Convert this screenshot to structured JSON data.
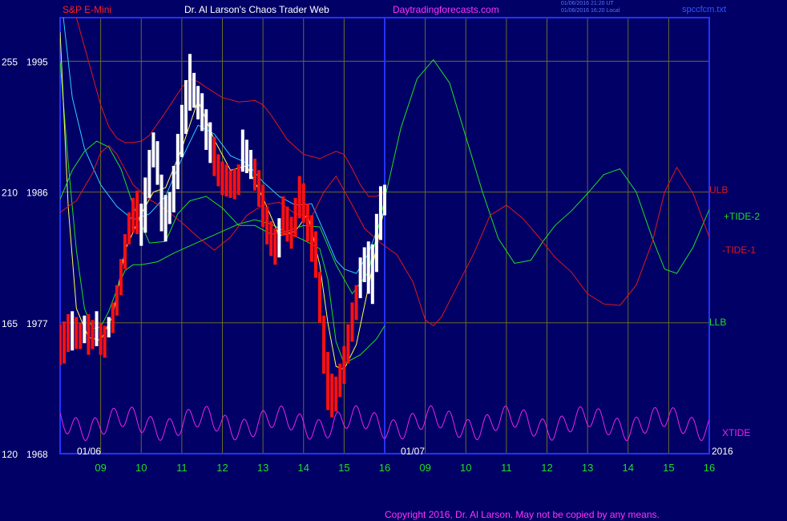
{
  "header": {
    "symbol": "S&P E-Mini",
    "author": "Dr. Al Larson's Chaos Trader Web",
    "site": "Daytradingforecasts.com",
    "stamp_line1": "01/06/2016 21:20 UT",
    "stamp_line2": "01/06/2016 16:20 Local",
    "file": "spccfcm.txt"
  },
  "footer": {
    "copyright": "Copyright 2016, Dr. Al Larson. May not be copied by any means."
  },
  "colors": {
    "background": "#000066",
    "frame": "#2233ff",
    "grid": "#6b6b2a",
    "price_up": "#ffffff",
    "price_down": "#ff1010",
    "ulb": "#e01818",
    "llb": "#22dd22",
    "tide2": "#22dd22",
    "tide1": "#e01818",
    "xtide": "#ee22ee",
    "fast_ma": "#ffff55",
    "slow_ma": "#33ccff"
  },
  "chart_data": {
    "type": "line",
    "title": "S&P E-Mini",
    "x_ticks": [
      "09",
      "10",
      "11",
      "12",
      "13",
      "14",
      "15",
      "16",
      "09",
      "10",
      "11",
      "12",
      "13",
      "14",
      "15",
      "16"
    ],
    "x_labels": {
      "start": "01/06",
      "forecast_start": "01/07",
      "year": "2016"
    },
    "y_ticks": [
      {
        "left": "255",
        "right": "1995",
        "value": 1995
      },
      {
        "left": "210",
        "right": "1986",
        "value": 1986
      },
      {
        "left": "165",
        "right": "1977",
        "value": 1977
      },
      {
        "left": "120",
        "right": "1968",
        "value": 1968
      }
    ],
    "ylim": [
      1968,
      1998
    ],
    "xlim": [
      8.0,
      24.0
    ],
    "forecast_divider_x": 16.0,
    "series_labels": {
      "ULB": "ULB",
      "TIDE2": "+TIDE-2",
      "TIDE1": "-TIDE-1",
      "LLB": "LLB",
      "XTIDE": "XTIDE"
    },
    "price_bars": [
      {
        "x": 8.0,
        "high": 1976.9,
        "low": 1974.1,
        "up": false
      },
      {
        "x": 8.1,
        "high": 1977.1,
        "low": 1974.2,
        "up": false
      },
      {
        "x": 8.2,
        "high": 1977.6,
        "low": 1975.0,
        "up": false
      },
      {
        "x": 8.3,
        "high": 1977.8,
        "low": 1975.1,
        "up": true
      },
      {
        "x": 8.4,
        "high": 1977.4,
        "low": 1975.2,
        "up": false
      },
      {
        "x": 8.5,
        "high": 1977.0,
        "low": 1975.2,
        "up": false
      },
      {
        "x": 8.6,
        "high": 1977.5,
        "low": 1975.6,
        "up": true
      },
      {
        "x": 8.7,
        "high": 1977.6,
        "low": 1974.8,
        "up": false
      },
      {
        "x": 8.8,
        "high": 1977.2,
        "low": 1975.2,
        "up": false
      },
      {
        "x": 8.9,
        "high": 1977.8,
        "low": 1975.4,
        "up": true
      },
      {
        "x": 9.0,
        "high": 1977.0,
        "low": 1974.8,
        "up": false
      },
      {
        "x": 9.1,
        "high": 1976.8,
        "low": 1974.6,
        "up": false
      },
      {
        "x": 9.2,
        "high": 1977.4,
        "low": 1976.0,
        "up": true
      },
      {
        "x": 9.3,
        "high": 1978.4,
        "low": 1976.3,
        "up": false
      },
      {
        "x": 9.4,
        "high": 1979.6,
        "low": 1977.5,
        "up": false
      },
      {
        "x": 9.5,
        "high": 1981.4,
        "low": 1978.9,
        "up": false
      },
      {
        "x": 9.6,
        "high": 1983.1,
        "low": 1980.7,
        "up": false
      },
      {
        "x": 9.7,
        "high": 1984.6,
        "low": 1982.4,
        "up": false
      },
      {
        "x": 9.8,
        "high": 1985.6,
        "low": 1983.2,
        "up": false
      },
      {
        "x": 9.9,
        "high": 1986.1,
        "low": 1983.1,
        "up": false
      },
      {
        "x": 10.0,
        "high": 1985.2,
        "low": 1982.3,
        "up": true
      },
      {
        "x": 10.1,
        "high": 1987.0,
        "low": 1983.2,
        "up": true
      },
      {
        "x": 10.2,
        "high": 1988.9,
        "low": 1985.6,
        "up": true
      },
      {
        "x": 10.3,
        "high": 1990.1,
        "low": 1987.7,
        "up": true
      },
      {
        "x": 10.4,
        "high": 1989.5,
        "low": 1986.5,
        "up": true
      },
      {
        "x": 10.5,
        "high": 1987.2,
        "low": 1983.3,
        "up": true
      },
      {
        "x": 10.6,
        "high": 1985.8,
        "low": 1982.6,
        "up": true
      },
      {
        "x": 10.7,
        "high": 1986.0,
        "low": 1983.8,
        "up": true
      },
      {
        "x": 10.8,
        "high": 1987.8,
        "low": 1984.6,
        "up": true
      },
      {
        "x": 10.9,
        "high": 1990.0,
        "low": 1986.2,
        "up": true
      },
      {
        "x": 11.0,
        "high": 1992.0,
        "low": 1988.4,
        "up": true
      },
      {
        "x": 11.1,
        "high": 1993.7,
        "low": 1990.0,
        "up": true
      },
      {
        "x": 11.2,
        "high": 1995.5,
        "low": 1991.6,
        "up": true
      },
      {
        "x": 11.3,
        "high": 1994.2,
        "low": 1991.8,
        "up": true
      },
      {
        "x": 11.4,
        "high": 1993.3,
        "low": 1991.0,
        "up": true
      },
      {
        "x": 11.5,
        "high": 1992.8,
        "low": 1990.2,
        "up": true
      },
      {
        "x": 11.6,
        "high": 1991.7,
        "low": 1988.9,
        "up": true
      },
      {
        "x": 11.7,
        "high": 1990.8,
        "low": 1988.0,
        "up": true
      },
      {
        "x": 11.8,
        "high": 1989.8,
        "low": 1987.1,
        "up": false
      },
      {
        "x": 11.9,
        "high": 1988.6,
        "low": 1986.4,
        "up": false
      },
      {
        "x": 12.0,
        "high": 1988.1,
        "low": 1985.8,
        "up": false
      },
      {
        "x": 12.1,
        "high": 1987.9,
        "low": 1985.7,
        "up": false
      },
      {
        "x": 12.2,
        "high": 1987.5,
        "low": 1985.6,
        "up": false
      },
      {
        "x": 12.3,
        "high": 1987.6,
        "low": 1985.5,
        "up": false
      },
      {
        "x": 12.4,
        "high": 1987.9,
        "low": 1985.8,
        "up": false
      },
      {
        "x": 12.5,
        "high": 1990.3,
        "low": 1987.4,
        "up": true
      },
      {
        "x": 12.6,
        "high": 1989.6,
        "low": 1987.3,
        "up": true
      },
      {
        "x": 12.7,
        "high": 1988.9,
        "low": 1986.9,
        "up": true
      },
      {
        "x": 12.8,
        "high": 1988.3,
        "low": 1986.1,
        "up": false
      },
      {
        "x": 12.9,
        "high": 1987.5,
        "low": 1985.0,
        "up": false
      },
      {
        "x": 13.0,
        "high": 1986.5,
        "low": 1983.6,
        "up": false
      },
      {
        "x": 13.1,
        "high": 1985.0,
        "low": 1982.4,
        "up": false
      },
      {
        "x": 13.2,
        "high": 1984.0,
        "low": 1981.6,
        "up": false
      },
      {
        "x": 13.3,
        "high": 1983.5,
        "low": 1981.0,
        "up": false
      },
      {
        "x": 13.4,
        "high": 1984.2,
        "low": 1981.5,
        "up": true
      },
      {
        "x": 13.5,
        "high": 1985.7,
        "low": 1983.0,
        "up": false
      },
      {
        "x": 13.6,
        "high": 1985.0,
        "low": 1982.6,
        "up": false
      },
      {
        "x": 13.7,
        "high": 1984.3,
        "low": 1982.1,
        "up": false
      },
      {
        "x": 13.8,
        "high": 1985.6,
        "low": 1982.9,
        "up": false
      },
      {
        "x": 13.9,
        "high": 1987.1,
        "low": 1984.2,
        "up": false
      },
      {
        "x": 14.0,
        "high": 1986.6,
        "low": 1983.9,
        "up": false
      },
      {
        "x": 14.1,
        "high": 1985.2,
        "low": 1982.6,
        "up": false
      },
      {
        "x": 14.2,
        "high": 1984.4,
        "low": 1981.2,
        "up": false
      },
      {
        "x": 14.3,
        "high": 1983.3,
        "low": 1980.1,
        "up": false
      },
      {
        "x": 14.4,
        "high": 1980.5,
        "low": 1977.0,
        "up": false
      },
      {
        "x": 14.5,
        "high": 1977.5,
        "low": 1973.5,
        "up": false
      },
      {
        "x": 14.6,
        "high": 1975.0,
        "low": 1971.0,
        "up": false
      },
      {
        "x": 14.7,
        "high": 1973.5,
        "low": 1970.5,
        "up": false
      },
      {
        "x": 14.8,
        "high": 1973.3,
        "low": 1970.9,
        "up": false
      },
      {
        "x": 14.9,
        "high": 1974.2,
        "low": 1971.9,
        "up": false
      },
      {
        "x": 15.0,
        "high": 1975.4,
        "low": 1972.8,
        "up": false
      },
      {
        "x": 15.1,
        "high": 1976.9,
        "low": 1974.2,
        "up": false
      },
      {
        "x": 15.2,
        "high": 1978.4,
        "low": 1975.7,
        "up": false
      },
      {
        "x": 15.3,
        "high": 1979.6,
        "low": 1977.2,
        "up": false
      },
      {
        "x": 15.4,
        "high": 1981.5,
        "low": 1978.7,
        "up": true
      },
      {
        "x": 15.5,
        "high": 1982.2,
        "low": 1979.8,
        "up": true
      },
      {
        "x": 15.6,
        "high": 1982.6,
        "low": 1979.0,
        "up": true
      },
      {
        "x": 15.7,
        "high": 1982.4,
        "low": 1978.3,
        "up": true
      },
      {
        "x": 15.8,
        "high": 1984.5,
        "low": 1980.5,
        "up": true
      },
      {
        "x": 15.9,
        "high": 1986.4,
        "low": 1982.7,
        "up": true
      },
      {
        "x": 16.0,
        "high": 1986.5,
        "low": 1984.4,
        "up": true
      }
    ],
    "lines": [
      {
        "key": "ULB",
        "color_key": "ulb",
        "width": 1,
        "x": [
          8.0,
          8.4,
          8.8,
          9.0,
          9.2,
          9.4,
          9.6,
          9.8,
          10.0,
          10.2,
          10.6,
          11.0,
          11.2,
          11.4,
          11.6,
          12.0,
          12.4,
          12.8,
          13.0,
          13.2,
          13.6,
          14.0,
          14.4,
          14.8,
          15.0,
          15.2,
          15.4,
          15.6,
          15.8,
          16.0
        ],
        "y": [
          2000,
          1998,
          1994,
          1992,
          1990.5,
          1989.7,
          1989.4,
          1989.4,
          1989.5,
          1989.9,
          1991.5,
          1993.2,
          1993.8,
          1993.6,
          1993.2,
          1992.5,
          1992.2,
          1992.3,
          1992,
          1991.3,
          1989.6,
          1988.6,
          1988.3,
          1988.8,
          1988.6,
          1987.6,
          1986.5,
          1985.7,
          1985.7,
          1986
        ]
      },
      {
        "key": "LLB",
        "color_key": "llb",
        "width": 1,
        "x": [
          8.0,
          8.2,
          8.4,
          8.6,
          8.8,
          9.0,
          9.2,
          9.4,
          9.6,
          9.8,
          10.0,
          10.4,
          10.8,
          11.2,
          11.6,
          12.0,
          12.4,
          12.8,
          13.2,
          13.6,
          14.0,
          14.4,
          14.6,
          14.8,
          15.0,
          15.4,
          15.8,
          16.0
        ],
        "y": [
          1995,
          1988,
          1982,
          1978,
          1976.6,
          1976.7,
          1977.8,
          1979.3,
          1980.6,
          1981,
          1981,
          1981.2,
          1981.8,
          1982.3,
          1982.8,
          1983.3,
          1983.8,
          1984.1,
          1983.8,
          1983.2,
          1982.7,
          1982.1,
          1980,
          1975.7,
          1974.2,
          1974.8,
          1975.9,
          1976.8
        ]
      },
      {
        "key": "FAST",
        "color_key": "fast_ma",
        "width": 1,
        "x": [
          8.0,
          8.2,
          8.4,
          8.7,
          9.0,
          9.3,
          9.6,
          10.0,
          10.3,
          10.6,
          11.0,
          11.4,
          11.8,
          12.2,
          12.6,
          13.0,
          13.4,
          13.8,
          14.1,
          14.4,
          14.6,
          14.8,
          15.0,
          15.3,
          15.6,
          16.0
        ],
        "y": [
          1997,
          1985,
          1978,
          1976,
          1975.8,
          1977.5,
          1982,
          1984.5,
          1986,
          1986.3,
          1989,
          1992.3,
          1989.6,
          1987.5,
          1987.8,
          1985.6,
          1983,
          1983.3,
          1984.5,
          1981,
          1977,
          1974,
          1973.8,
          1975.5,
          1979.5,
          1985
        ]
      },
      {
        "key": "SLOW",
        "color_key": "slow_ma",
        "width": 1,
        "x": [
          8.0,
          8.3,
          8.6,
          9.0,
          9.4,
          9.8,
          10.2,
          10.6,
          11.0,
          11.4,
          11.8,
          12.2,
          12.6,
          13.0,
          13.4,
          13.8,
          14.2,
          14.5,
          14.8,
          15.0,
          15.3,
          15.6,
          16.0
        ],
        "y": [
          2000,
          1992.5,
          1989,
          1986.5,
          1985,
          1984.1,
          1984.5,
          1985.7,
          1988.3,
          1990.6,
          1990,
          1988.5,
          1988,
          1986.7,
          1985.7,
          1985.1,
          1985.2,
          1983.3,
          1981.3,
          1980.7,
          1980.4,
          1981.8,
          1984.8
        ]
      },
      {
        "key": "TIDE2",
        "color_key": "tide2",
        "width": 1,
        "x": [
          8.0,
          8.3,
          8.6,
          8.9,
          9.2,
          9.5,
          9.8,
          10.2,
          10.6,
          10.9,
          11.2,
          11.6,
          12.0,
          12.4,
          12.8,
          13.2,
          13.6,
          14.0,
          14.4,
          14.8,
          15.2,
          15.6,
          16.0,
          16.4,
          16.8,
          17.2,
          17.6,
          18.0,
          18.4,
          18.8,
          19.2,
          19.6,
          19.9,
          20.2,
          20.6,
          21.0,
          21.4,
          21.8,
          22.2,
          22.6,
          22.9,
          23.2,
          23.6,
          24.0
        ],
        "y": [
          1985.5,
          1987.5,
          1988.8,
          1989.5,
          1989.1,
          1987.6,
          1985.1,
          1982.5,
          1982.6,
          1984.5,
          1985.4,
          1985.7,
          1984.9,
          1983.7,
          1983.7,
          1983.1,
          1983.3,
          1983.7,
          1983.6,
          1981,
          1979,
          1980.5,
          1985.5,
          1990.4,
          1993.8,
          1995.1,
          1993.5,
          1989.8,
          1986.1,
          1982.8,
          1981.1,
          1981.3,
          1982.6,
          1983.7,
          1984.7,
          1985.9,
          1987.2,
          1987.6,
          1986,
          1982.8,
          1980.7,
          1980.4,
          1982.2,
          1984.8
        ]
      },
      {
        "key": "TIDE1",
        "color_key": "tide1",
        "width": 1,
        "x": [
          8.0,
          8.4,
          8.8,
          9.0,
          9.2,
          9.4,
          9.8,
          10.2,
          10.6,
          11.0,
          11.4,
          11.8,
          12.2,
          12.6,
          13.0,
          13.4,
          13.8,
          14.2,
          14.5,
          14.8,
          15.2,
          15.5,
          15.9,
          16.3,
          16.7,
          17.0,
          17.2,
          17.4,
          17.8,
          18.2,
          18.6,
          19.0,
          19.4,
          19.8,
          20.2,
          20.6,
          21.0,
          21.4,
          21.8,
          22.2,
          22.6,
          22.9,
          23.2,
          23.6,
          24.0
        ],
        "y": [
          1984.6,
          1985.4,
          1987.3,
          1988.7,
          1989.2,
          1988.6,
          1986.5,
          1985.5,
          1984.8,
          1983.9,
          1982.9,
          1982,
          1982.9,
          1984.4,
          1985.1,
          1985.3,
          1984.5,
          1984.3,
          1986,
          1987.1,
          1985.1,
          1983.5,
          1982.5,
          1981.7,
          1979.8,
          1977.2,
          1976.8,
          1977.4,
          1979.6,
          1981.8,
          1984.4,
          1985.1,
          1984.2,
          1982.9,
          1981.5,
          1980.5,
          1979,
          1978.3,
          1978.2,
          1979.6,
          1982.6,
          1986,
          1987.7,
          1985.9,
          1982.9
        ]
      }
    ],
    "xtide": {
      "base": 1970.1,
      "amp": 1.2,
      "period": 0.46,
      "slow_period": 1.9,
      "x_range": [
        8.0,
        24.0
      ]
    }
  }
}
